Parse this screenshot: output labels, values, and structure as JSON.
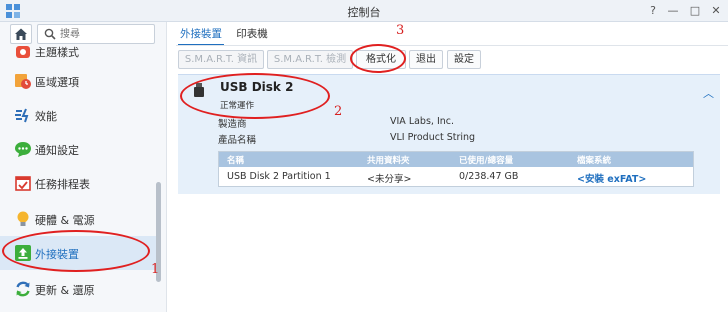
{
  "window": {
    "title": "控制台",
    "controls": [
      "?",
      "—",
      "□",
      "✕"
    ]
  },
  "sidebar": {
    "search_placeholder": "搜尋",
    "items": [
      {
        "label": "主題樣式",
        "icon": "theme-icon"
      },
      {
        "label": "區域選項",
        "icon": "clock-icon"
      },
      {
        "label": "效能",
        "icon": "performance-icon"
      },
      {
        "label": "通知設定",
        "icon": "chat-bubble-icon"
      },
      {
        "label": "任務排程表",
        "icon": "calendar-icon"
      },
      {
        "label": "硬體 & 電源",
        "icon": "lightbulb-icon"
      },
      {
        "label": "外接裝置",
        "icon": "external-device-icon"
      },
      {
        "label": "更新 & 還原",
        "icon": "refresh-icon"
      }
    ]
  },
  "tabs": [
    {
      "label": "外接裝置",
      "active": true
    },
    {
      "label": "印表機",
      "active": false
    }
  ],
  "toolbar": {
    "smart_info": "S.M.A.R.T. 資訊",
    "smart_test": "S.M.A.R.T. 檢測",
    "format": "格式化",
    "eject": "退出",
    "settings": "設定"
  },
  "device": {
    "name": "USB Disk 2",
    "status": "正常運作",
    "manufacturer_label": "製造商",
    "manufacturer": "VIA Labs, Inc.",
    "product_label": "產品名稱",
    "product": "VLI Product String"
  },
  "partition_table": {
    "headers": [
      "名稱",
      "共用資料夾",
      "已使用/總容量",
      "檔案系統"
    ],
    "rows": [
      [
        "USB Disk 2 Partition 1",
        "<未分享>",
        "0/238.47 GB",
        "<安裝 exFAT>"
      ]
    ]
  },
  "annotations": [
    "1",
    "2",
    "3"
  ],
  "colors": {
    "accent": "#1f6fbf",
    "annotation": "#e02020",
    "panel_bg": "#e6f0fa",
    "table_header": "#a9c4e0"
  }
}
